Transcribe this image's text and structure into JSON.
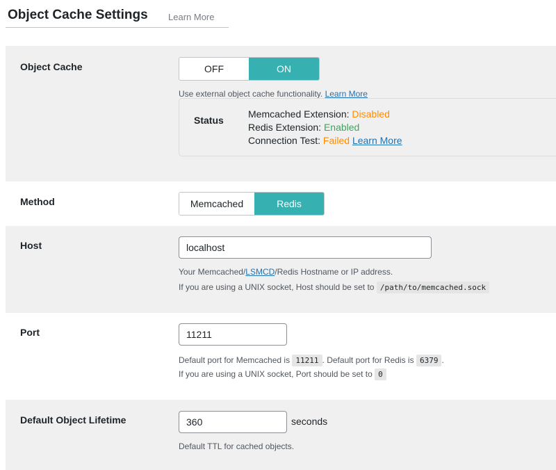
{
  "header": {
    "title": "Object Cache Settings",
    "learn_more": "Learn More"
  },
  "object_cache": {
    "label": "Object Cache",
    "toggle": {
      "off": "OFF",
      "on": "ON",
      "selected": "ON"
    },
    "description": "Use external object cache functionality.",
    "learn_more": "Learn More",
    "status": {
      "label": "Status",
      "memcached_label": "Memcached Extension:",
      "memcached_value": "Disabled",
      "redis_label": "Redis Extension:",
      "redis_value": "Enabled",
      "connection_label": "Connection Test:",
      "connection_value": "Failed",
      "learn_more": "Learn More"
    }
  },
  "method": {
    "label": "Method",
    "options": [
      "Memcached",
      "Redis"
    ],
    "selected": "Redis"
  },
  "host": {
    "label": "Host",
    "value": "localhost",
    "desc_prefix": "Your Memcached/",
    "desc_link": "LSMCD",
    "desc_suffix": "/Redis Hostname or IP address.",
    "socket_text": "If you are using a UNIX socket, Host should be set to",
    "socket_value": "/path/to/memcached.sock"
  },
  "port": {
    "label": "Port",
    "value": "11211",
    "desc_a": "Default port for Memcached is",
    "memcached_port": "11211",
    "desc_b": ". Default port for Redis is",
    "redis_port": "6379",
    "desc_c": ".",
    "socket_text": "If you are using a UNIX socket, Port should be set to",
    "socket_value": "0"
  },
  "lifetime": {
    "label": "Default Object Lifetime",
    "value": "360",
    "unit": "seconds",
    "description": "Default TTL for cached objects."
  },
  "colors": {
    "accent": "#36b0b0",
    "link": "#2271b1",
    "warning": "#ff8c00",
    "success": "#3aa65c",
    "row_background": "#f0f0f1"
  }
}
